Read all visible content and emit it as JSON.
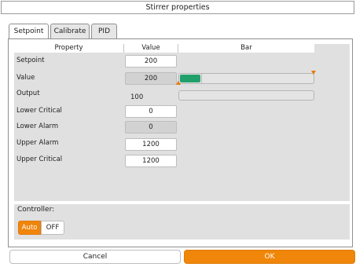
{
  "window": {
    "title": "Stirrer properties"
  },
  "tabs": [
    {
      "label": "Setpoint"
    },
    {
      "label": "Calibrate"
    },
    {
      "label": "PID"
    }
  ],
  "table": {
    "headers": {
      "property": "Property",
      "value": "Value",
      "bar": "Bar"
    },
    "rows": [
      {
        "label": "Setpoint",
        "value": "200"
      },
      {
        "label": "Value",
        "value": "200"
      },
      {
        "label": "Output",
        "value": "100"
      },
      {
        "label": "Lower Critical",
        "value": "0"
      },
      {
        "label": "Lower Alarm",
        "value": "0"
      },
      {
        "label": "Upper Alarm",
        "value": "1200"
      },
      {
        "label": "Upper Critical",
        "value": "1200"
      }
    ]
  },
  "controller": {
    "label": "Controller:",
    "auto_label": "Auto",
    "off_label": "OFF",
    "selected": "Auto"
  },
  "buttons": {
    "cancel": "Cancel",
    "ok": "OK"
  },
  "colors": {
    "accent": "#f0850c",
    "bar_fill": "#22a06b"
  }
}
